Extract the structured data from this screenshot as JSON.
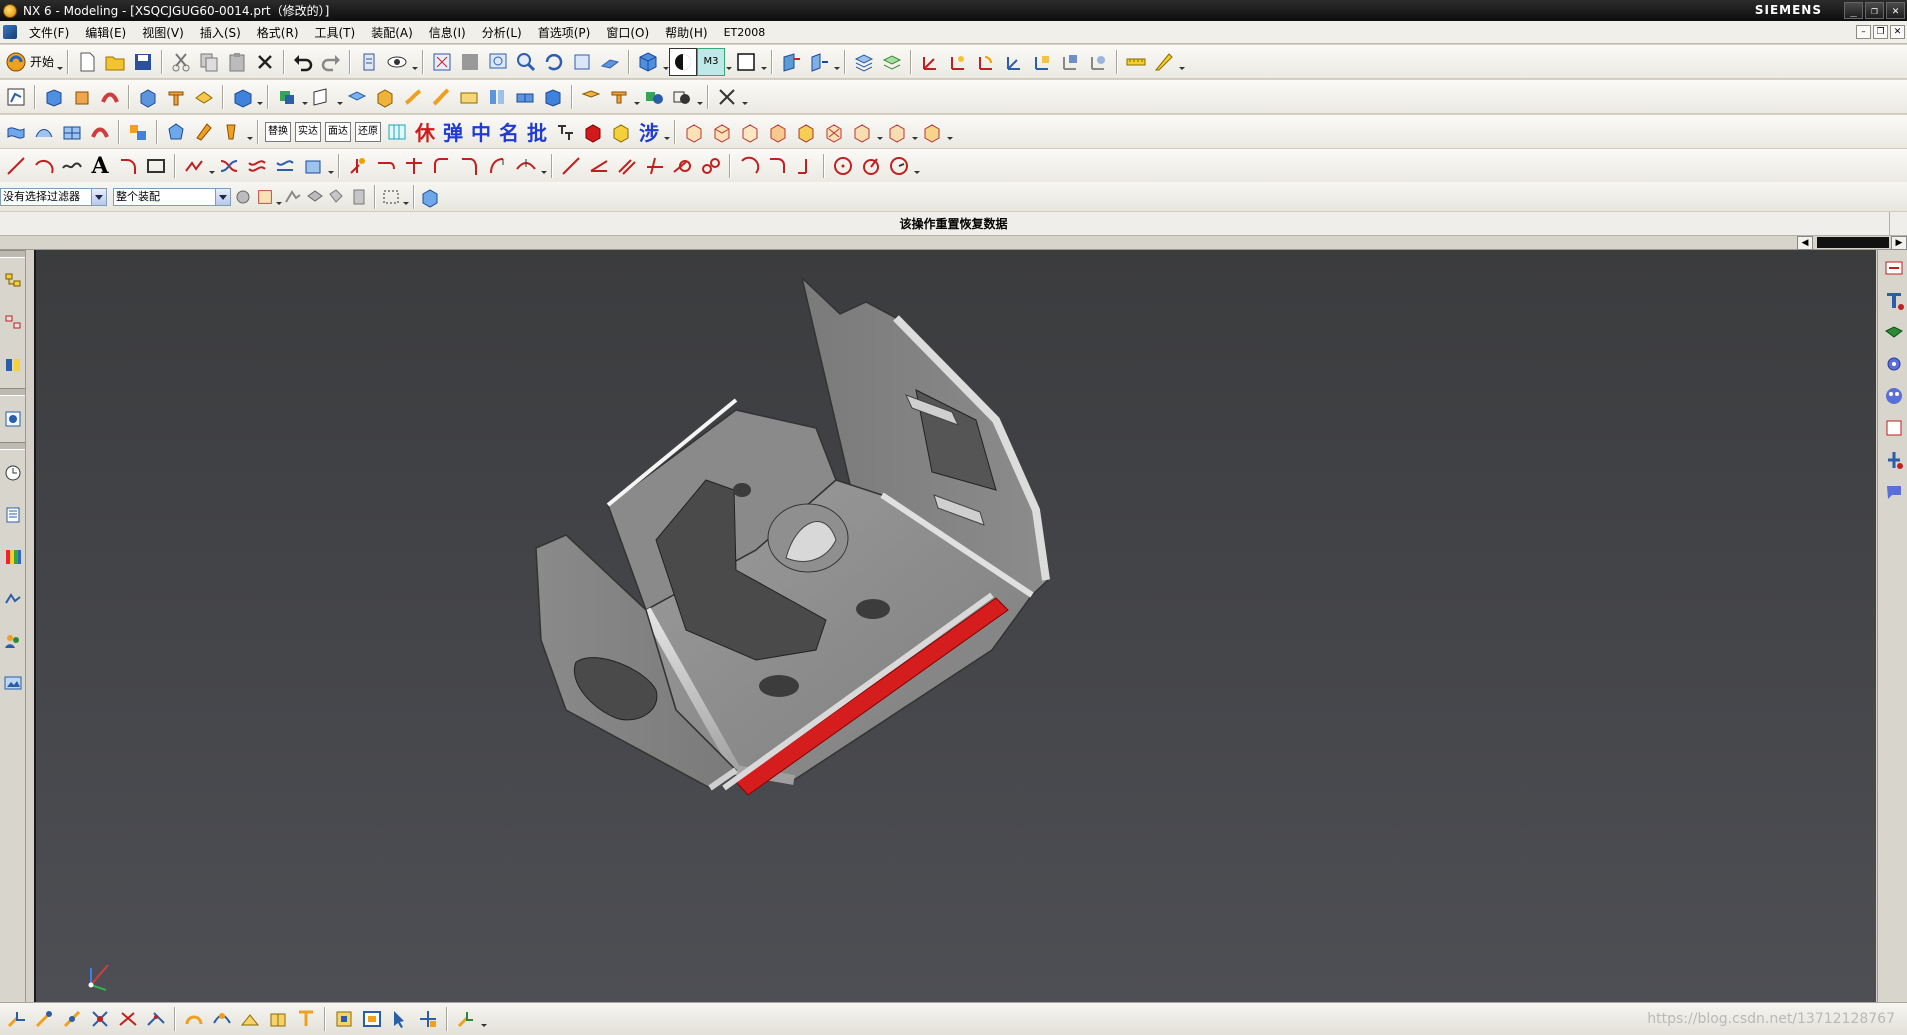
{
  "window": {
    "title": "NX 6 - Modeling - [XSQCJGUG60-0014.prt（修改的）]",
    "brand": "SIEMENS",
    "buttons": {
      "minimize": "_",
      "restore": "❐",
      "close": "✕"
    }
  },
  "menu": {
    "items": [
      "文件(F)",
      "编辑(E)",
      "视图(V)",
      "插入(S)",
      "格式(R)",
      "工具(T)",
      "装配(A)",
      "信息(I)",
      "分析(L)",
      "首选项(P)",
      "窗口(O)",
      "帮助(H)",
      "ET2008"
    ],
    "doc_buttons": [
      "–",
      "❐",
      "✕"
    ]
  },
  "toolbar": {
    "start_label": "开始",
    "render_mode_label": "M3",
    "text_buttons": [
      "替换",
      "实达",
      "面达",
      "还原"
    ],
    "hanzi_buttons": [
      "休",
      "弹",
      "中",
      "名",
      "批"
    ],
    "hanzi_step": "涉"
  },
  "selection_bar": {
    "filter_value": "没有选择过滤器",
    "scope_value": "整个装配"
  },
  "cue_line": "该操作重置恢复数据",
  "watermark": "https://blog.csdn.net/13712128767",
  "colors": {
    "accent_red": "#d51d1d",
    "viewport_top": "#3b3c3e",
    "viewport_bottom": "#4e4f54",
    "part_grey": "#8a8a8a"
  }
}
